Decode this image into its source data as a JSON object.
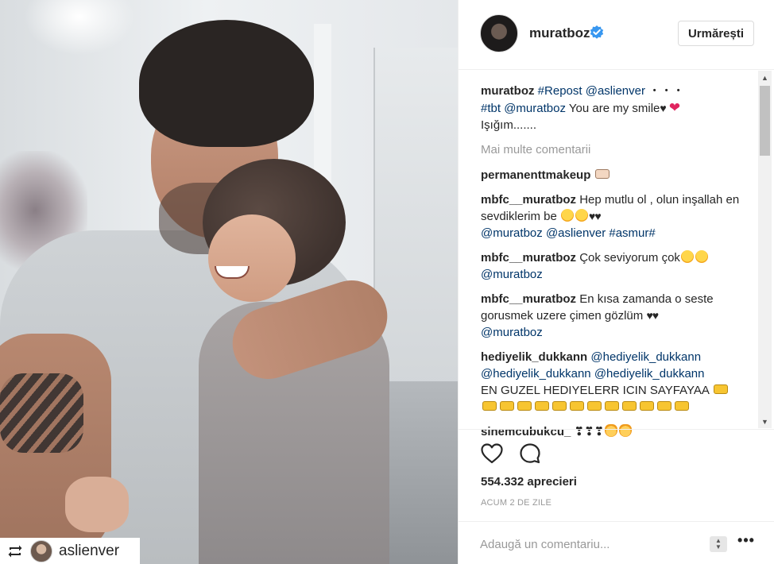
{
  "post": {
    "photo_alt": "",
    "repost_credit": {
      "username": "aslienver"
    }
  },
  "header": {
    "username": "muratboz",
    "verified": true,
    "follow_label": "Urmărești"
  },
  "caption": {
    "username": "muratboz",
    "parts": [
      "#Repost",
      "@aslienver",
      "・・・",
      "#tbt",
      "@muratboz",
      "You are my smile",
      "Işığım......."
    ]
  },
  "load_more_label": "Mai multe comentarii",
  "comments": [
    {
      "username": "permanenttmakeup",
      "text": ""
    },
    {
      "username": "mbfc__muratboz",
      "text": "Hep mutlu ol , olun inşallah en sevdiklerim be",
      "mentions": [
        "@muratboz",
        "@aslienver",
        "#asmur#"
      ]
    },
    {
      "username": "mbfc__muratboz",
      "text": "Çok seviyorum çok",
      "mentions": [
        "@muratboz"
      ]
    },
    {
      "username": "mbfc__muratboz",
      "text": "En kısa zamanda o seste gorusmek uzere çimen gözlüm",
      "mentions": [
        "@muratboz"
      ]
    },
    {
      "username": "hediyelik_dukkann",
      "mentions": [
        "@hediyelik_dukkann",
        "@hediyelik_dukkann",
        "@hediyelik_dukkann"
      ],
      "text": "EN GUZEL HEDIYELERR ICIN SAYFAYAA"
    },
    {
      "username": "sinemcubukcu_",
      "text": "❣❣❣"
    }
  ],
  "likes_text": "554.332 aprecieri",
  "time_text": "ACUM 2 DE ZILE",
  "comment_box": {
    "placeholder": "Adaugă un comentariu..."
  },
  "icons": {
    "like": "heart-outline-icon",
    "comment": "speech-bubble-icon",
    "repost": "repost-arrows-icon",
    "verified": "verified-badge-icon",
    "more": "more-options-icon"
  },
  "colors": {
    "link": "#003569",
    "verified": "#3897f0",
    "muted": "#999999"
  }
}
